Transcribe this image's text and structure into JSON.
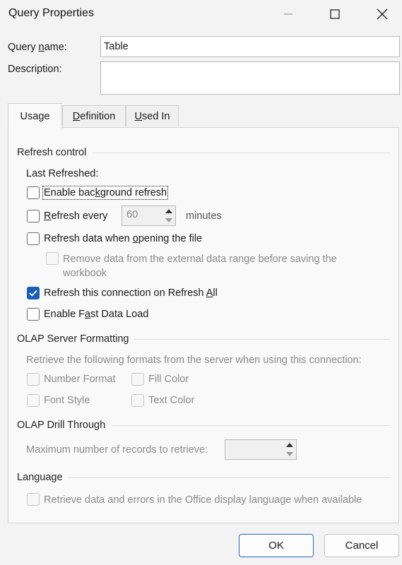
{
  "window": {
    "title": "Query Properties"
  },
  "fields": {
    "query_name_label_pre": "Query ",
    "query_name_label_u": "n",
    "query_name_label_post": "ame:",
    "query_name_value": "Table",
    "description_label": "Description:",
    "description_value": ""
  },
  "tabs": [
    {
      "pre": "",
      "u": "",
      "post": "Usage",
      "active": true
    },
    {
      "pre": "",
      "u": "D",
      "post": "efinition",
      "active": false
    },
    {
      "pre": "",
      "u": "U",
      "post": "sed In",
      "active": false
    }
  ],
  "refresh_control": {
    "heading": "Refresh control",
    "last_refreshed": "Last Refreshed:",
    "enable_background": {
      "pre": "Enable bac",
      "u": "k",
      "post": "ground refresh",
      "checked": false
    },
    "refresh_every": {
      "pre": "",
      "u": "R",
      "post": "efresh every",
      "checked": false,
      "value": "60",
      "unit": "minutes"
    },
    "refresh_on_open": {
      "pre": "Refresh data when ",
      "u": "o",
      "post": "pening the file",
      "checked": false
    },
    "remove_data_line1": "Remove data from the external data range before saving the",
    "remove_data_line2": "workbook",
    "refresh_all": {
      "pre": "Refresh this connection on Refresh ",
      "u": "A",
      "post": "ll",
      "checked": true
    },
    "fast_load": {
      "pre": "Enable F",
      "u": "a",
      "post": "st Data Load",
      "checked": false
    }
  },
  "olap_formatting": {
    "heading": "OLAP Server Formatting",
    "description": "Retrieve the following formats from the server when using this connection:",
    "number_format": "Number Format",
    "fill_color": "Fill Color",
    "font_style": "Font Style",
    "text_color": "Text Color"
  },
  "olap_drill": {
    "heading": "OLAP Drill Through",
    "max_records_label": "Maximum number of records to retrieve:",
    "max_records_value": ""
  },
  "language": {
    "heading": "Language",
    "retrieve_label": "Retrieve data and errors in the Office display language when available"
  },
  "buttons": {
    "ok": "OK",
    "cancel": "Cancel"
  },
  "colors": {
    "accent": "#1a5fb4",
    "background": "#f3f3f3",
    "disabled_text": "#8a8a8a"
  }
}
